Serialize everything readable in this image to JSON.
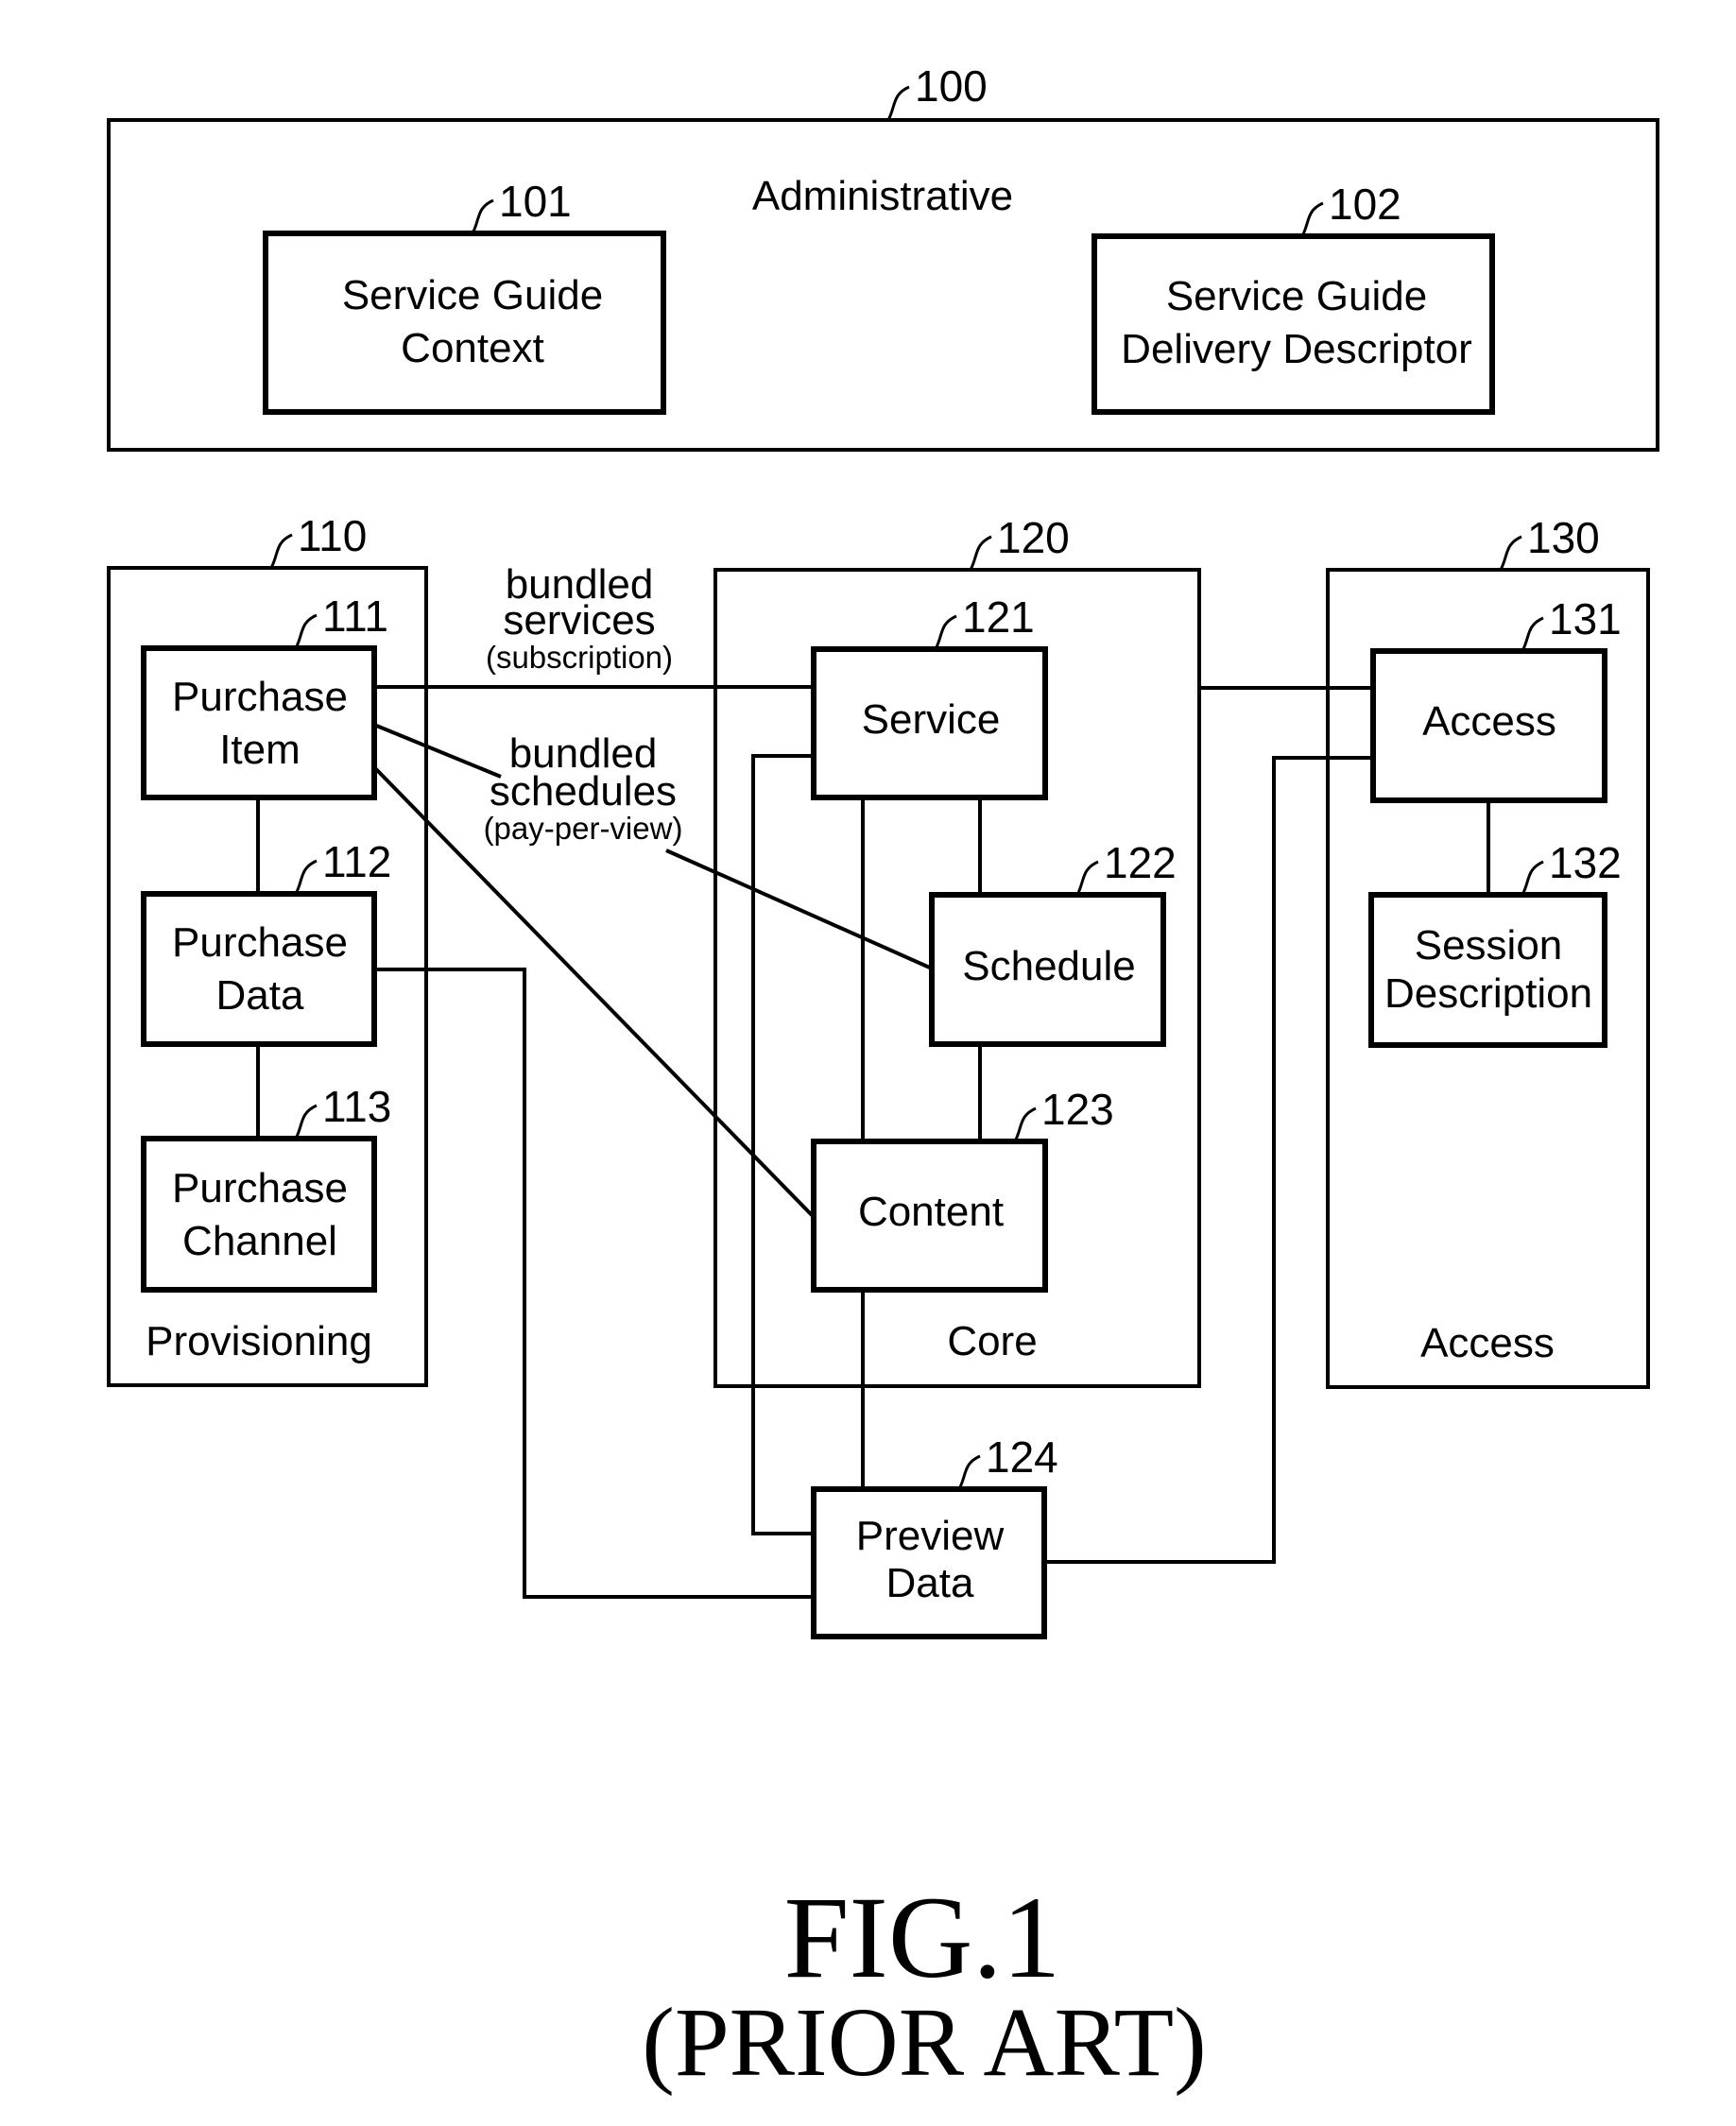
{
  "figure": {
    "title": "FIG.1",
    "subtitle": "(PRIOR ART)",
    "stroke_color": "#000000",
    "background": "#ffffff"
  },
  "groups": {
    "administrative": {
      "ref": "100",
      "label": "Administrative"
    },
    "provisioning": {
      "ref": "110",
      "label": "Provisioning"
    },
    "core": {
      "ref": "120",
      "label": "Core"
    },
    "access": {
      "ref": "130",
      "label": "Access"
    }
  },
  "blocks": {
    "service_guide_context": {
      "ref": "101",
      "lines": [
        "Service Guide",
        "Context"
      ]
    },
    "service_guide_delivery_descriptor": {
      "ref": "102",
      "lines": [
        "Service Guide",
        "Delivery Descriptor"
      ]
    },
    "purchase_item": {
      "ref": "111",
      "lines": [
        "Purchase",
        "Item"
      ]
    },
    "purchase_data": {
      "ref": "112",
      "lines": [
        "Purchase",
        "Data"
      ]
    },
    "purchase_channel": {
      "ref": "113",
      "lines": [
        "Purchase",
        "Channel"
      ]
    },
    "service": {
      "ref": "121",
      "lines": [
        "Service"
      ]
    },
    "schedule": {
      "ref": "122",
      "lines": [
        "Schedule"
      ]
    },
    "content": {
      "ref": "123",
      "lines": [
        "Content"
      ]
    },
    "preview_data": {
      "ref": "124",
      "lines": [
        "Preview",
        "Data"
      ]
    },
    "access": {
      "ref": "131",
      "lines": [
        "Access"
      ]
    },
    "session_description": {
      "ref": "132",
      "lines": [
        "Session",
        "Description"
      ]
    }
  },
  "edge_labels": {
    "bundled_services": {
      "lines": [
        "bundled",
        "services"
      ],
      "note": "(subscription)"
    },
    "bundled_schedules": {
      "lines": [
        "bundled",
        "schedules"
      ],
      "note": "(pay-per-view)"
    }
  },
  "connections": [
    {
      "from": "purchase_item",
      "to": "service",
      "label": "bundled_services"
    },
    {
      "from": "purchase_item",
      "to": "schedule",
      "label": "bundled_schedules"
    },
    {
      "from": "purchase_item",
      "to": "content"
    },
    {
      "from": "purchase_item",
      "to": "purchase_data"
    },
    {
      "from": "purchase_data",
      "to": "purchase_channel"
    },
    {
      "from": "purchase_data",
      "to": "preview_data"
    },
    {
      "from": "service",
      "to": "schedule"
    },
    {
      "from": "schedule",
      "to": "content"
    },
    {
      "from": "service",
      "to": "content"
    },
    {
      "from": "content",
      "to": "preview_data"
    },
    {
      "from": "service",
      "to": "preview_data"
    },
    {
      "from": "service",
      "to": "access"
    },
    {
      "from": "access",
      "to": "session_description"
    },
    {
      "from": "access",
      "to": "preview_data"
    }
  ]
}
